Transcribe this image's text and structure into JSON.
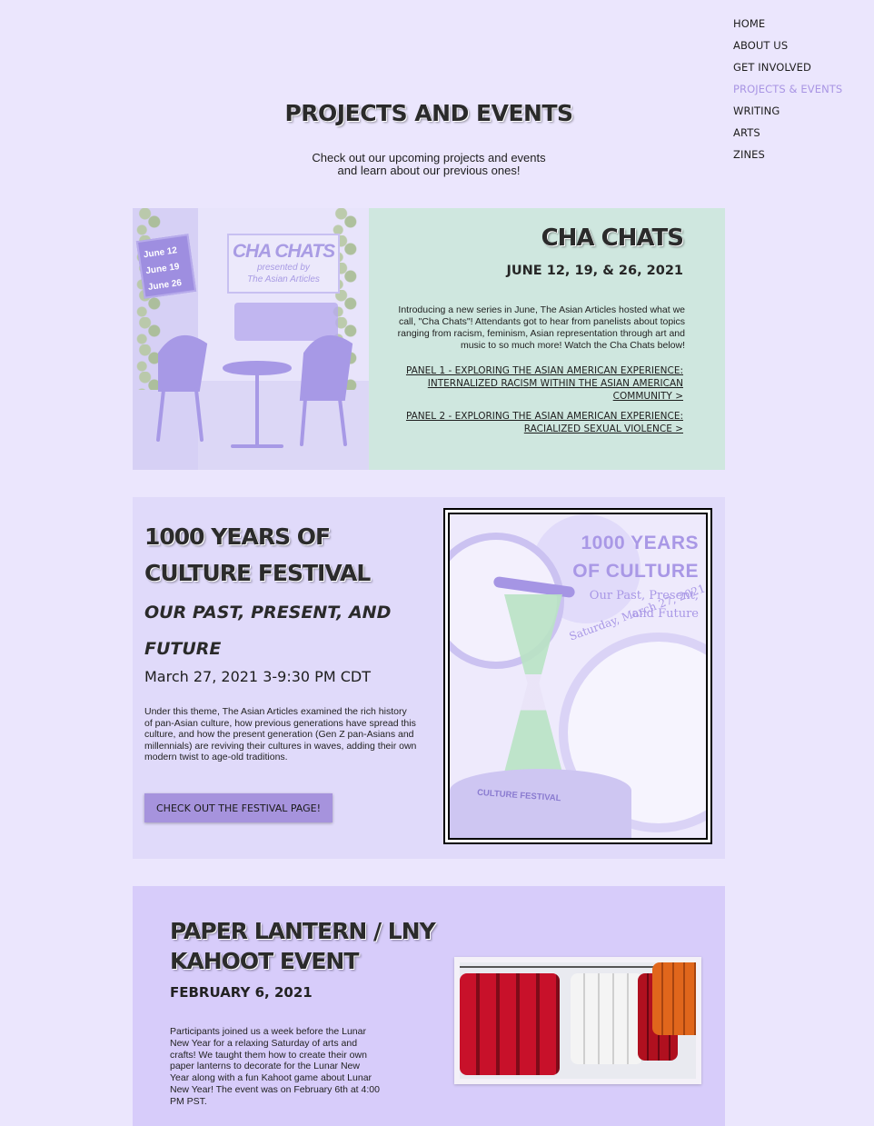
{
  "nav": {
    "items": [
      {
        "label": "HOME"
      },
      {
        "label": "ABOUT US"
      },
      {
        "label": "GET INVOLVED"
      },
      {
        "label": "PROJECTS & EVENTS"
      },
      {
        "label": "WRITING"
      },
      {
        "label": "ARTS"
      },
      {
        "label": "ZINES"
      }
    ],
    "active_color": "#a995e4"
  },
  "header": {
    "title": "PROJECTS AND EVENTS",
    "intro_line1": "Check out our upcoming projects and events",
    "intro_line2": "and learn about our previous ones!"
  },
  "cha_chats": {
    "title": "CHA CHATS",
    "date": "JUNE 12, 19, & 26, 2021",
    "description": "Introducing a new series in June, The Asian Articles hosted what we call, \"Cha Chats\"! Attendants got to hear from panelists about topics ranging from racism, feminism, Asian representation through art and music to so much more!  Watch the Cha Chats below!",
    "panel1": "PANEL 1 - EXPLORING THE ASIAN AMERICAN EXPERIENCE: INTERNALIZED RACISM WITHIN THE ASIAN AMERICAN COMMUNITY >",
    "panel2": "PANEL 2 - EXPLORING THE ASIAN AMERICAN EXPERIENCE: RACIALIZED SEXUAL VIOLENCE >",
    "image": {
      "dates": [
        "June 12",
        "June 19",
        "June 26"
      ],
      "sign_title": "CHA CHATS",
      "sign_presented": "presented by",
      "sign_org": "The Asian Articles"
    },
    "bg_color": "#cfe7df"
  },
  "festival": {
    "title": "1000 YEARS OF CULTURE FESTIVAL",
    "subtitle": "OUR PAST, PRESENT, AND FUTURE",
    "date": "March 27, 2021 3-9:30 PM CDT",
    "description": "Under this theme, The Asian Articles examined the rich history of pan-Asian culture, how previous generations have spread this culture, and how the present generation (Gen Z pan-Asians and millennials) are reviving their cultures in waves, adding their own modern twist to age-old traditions.",
    "button": "CHECK OUT THE FESTIVAL PAGE!",
    "poster": {
      "title_line1": "1000 YEARS",
      "title_line2": "OF CULTURE",
      "sub_line1": "Our Past, Present,",
      "sub_line2": "and Future",
      "date": "Saturday, March 27, 2021",
      "base": "CULTURE FESTIVAL"
    },
    "button_color": "#a693dd"
  },
  "lantern": {
    "title": "PAPER LANTERN / LNY KAHOOT EVENT",
    "date": "FEBRUARY 6, 2021",
    "description": "Participants joined us a week before the Lunar New Year for a relaxing Saturday of arts and crafts! We taught them how to create their own paper lanterns to decorate for the Lunar New Year along with a fun Kahoot game about Lunar New Year! The event was on February 6th at 4:00 PM PST.",
    "bg_color": "#d7ccfa"
  }
}
